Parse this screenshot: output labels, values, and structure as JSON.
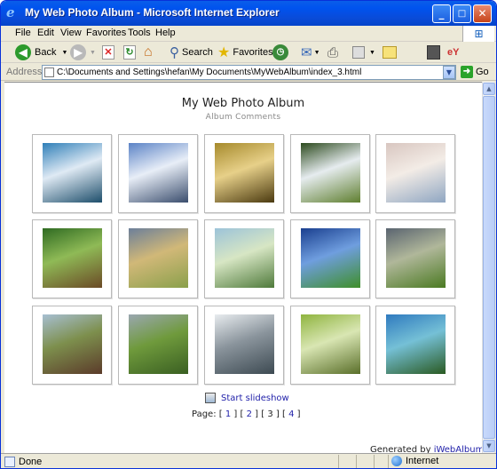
{
  "window": {
    "title": "My Web Photo Album - Microsoft Internet Explorer",
    "minimize": "_",
    "maximize": "□",
    "close": "✕"
  },
  "menu": [
    "File",
    "Edit",
    "View",
    "Favorites",
    "Tools",
    "Help"
  ],
  "toolbar": {
    "back": "Back",
    "search": "Search",
    "favorites": "Favorites"
  },
  "address": {
    "label": "Address",
    "url": "C:\\Documents and Settings\\hefan\\My Documents\\MyWebAlbum\\index_3.html",
    "go": "Go"
  },
  "album": {
    "title": "My Web Photo Album",
    "subtitle": "Album Comments",
    "photos": [
      {
        "icon": "mountain-lake-photo",
        "colors": [
          "#2f7fb8",
          "#dfeaf4",
          "#1d4e6b"
        ]
      },
      {
        "icon": "snowy-mountains-photo",
        "colors": [
          "#5b83c6",
          "#e8eef7",
          "#3a4d6d"
        ]
      },
      {
        "icon": "bamboo-hut-photo",
        "colors": [
          "#a68a2c",
          "#e7d089",
          "#4b3a10"
        ]
      },
      {
        "icon": "waterfall-photo",
        "colors": [
          "#2c4a1e",
          "#e6ecef",
          "#5f7f2f"
        ]
      },
      {
        "icon": "misty-lake-photo",
        "colors": [
          "#d8c6c0",
          "#f3ece6",
          "#8fa6c2"
        ]
      },
      {
        "icon": "forest-path-photo",
        "colors": [
          "#2f6b22",
          "#8fba56",
          "#6b4a26"
        ]
      },
      {
        "icon": "hay-bales-photo",
        "colors": [
          "#6c7f9a",
          "#d1b878",
          "#8aa04b"
        ]
      },
      {
        "icon": "river-valley-photo",
        "colors": [
          "#9cc3d9",
          "#d7e6c4",
          "#4f7a3b"
        ]
      },
      {
        "icon": "green-field-sky-photo",
        "colors": [
          "#1a3f8f",
          "#6f9edf",
          "#3f8f2a"
        ]
      },
      {
        "icon": "stormy-field-photo",
        "colors": [
          "#5a6470",
          "#b0b79a",
          "#4b7a22"
        ]
      },
      {
        "icon": "flooded-field-photo",
        "colors": [
          "#a7bfd2",
          "#7d8f4d",
          "#5b3b2a"
        ]
      },
      {
        "icon": "rolling-hills-photo",
        "colors": [
          "#9aa7b0",
          "#6f9a3c",
          "#3a5f22"
        ]
      },
      {
        "icon": "frosted-tree-photo",
        "colors": [
          "#e8ecef",
          "#8a949c",
          "#3d4a52"
        ]
      },
      {
        "icon": "willow-branches-photo",
        "colors": [
          "#8fb43f",
          "#d9e6b3",
          "#5a6f2a"
        ]
      },
      {
        "icon": "blue-lake-forest-photo",
        "colors": [
          "#2f7abf",
          "#75c0d6",
          "#2a5a22"
        ]
      }
    ],
    "slideshow": "Start slideshow",
    "pager_label": "Page:",
    "pages": [
      "1",
      "2",
      "3",
      "4"
    ],
    "current_page": "3",
    "generated_prefix": "Generated by",
    "generated_link": "iWebAlbum"
  },
  "status": {
    "left": "Done",
    "zone": "Internet"
  }
}
